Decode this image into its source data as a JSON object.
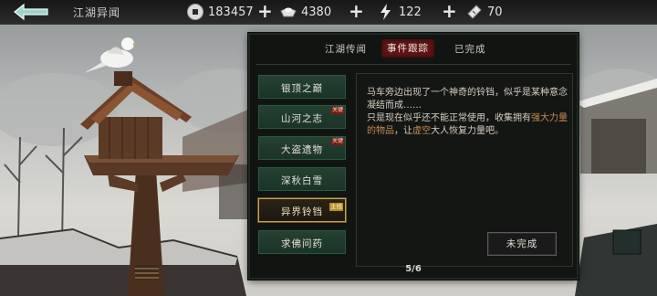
{
  "header": {
    "title": "江湖异闻",
    "resources": [
      {
        "icon": "coin-icon",
        "value": "183457"
      },
      {
        "icon": "silver-ingot-icon",
        "value": "4380"
      },
      {
        "icon": "lightning-icon",
        "value": "122"
      },
      {
        "icon": "ticket-icon",
        "value": "70"
      }
    ]
  },
  "tabs": [
    {
      "label": "江湖传闻"
    },
    {
      "label": "事件跟踪",
      "active": true
    },
    {
      "label": "已完成"
    }
  ],
  "events": [
    {
      "label": "银顶之巅",
      "badge": ""
    },
    {
      "label": "山河之志",
      "badge": "关键"
    },
    {
      "label": "大盗遗物",
      "badge": "关键"
    },
    {
      "label": "深秋白雪",
      "badge": ""
    },
    {
      "label": "异界铃铛",
      "badge": "主线",
      "selected": true
    },
    {
      "label": "求佛问药",
      "badge": ""
    }
  ],
  "detail": {
    "line1": "马车旁边出现了一个神奇的铃铛，似乎是某种意念凝结而成……",
    "line2_pre": "只是现在似乎还不能正常使用，收集拥有",
    "line2_hl1": "强大力量的物品",
    "line2_mid": "，让",
    "line2_hl2": "虚空",
    "line2_post": "大人恢复力量吧。",
    "status_label": "未完成"
  },
  "pager": "5/6",
  "colors": {
    "accent_tab": "#5c1512",
    "selected_border": "#c9a356",
    "highlight_text": "#c88b4f",
    "event_green": "#244232"
  }
}
